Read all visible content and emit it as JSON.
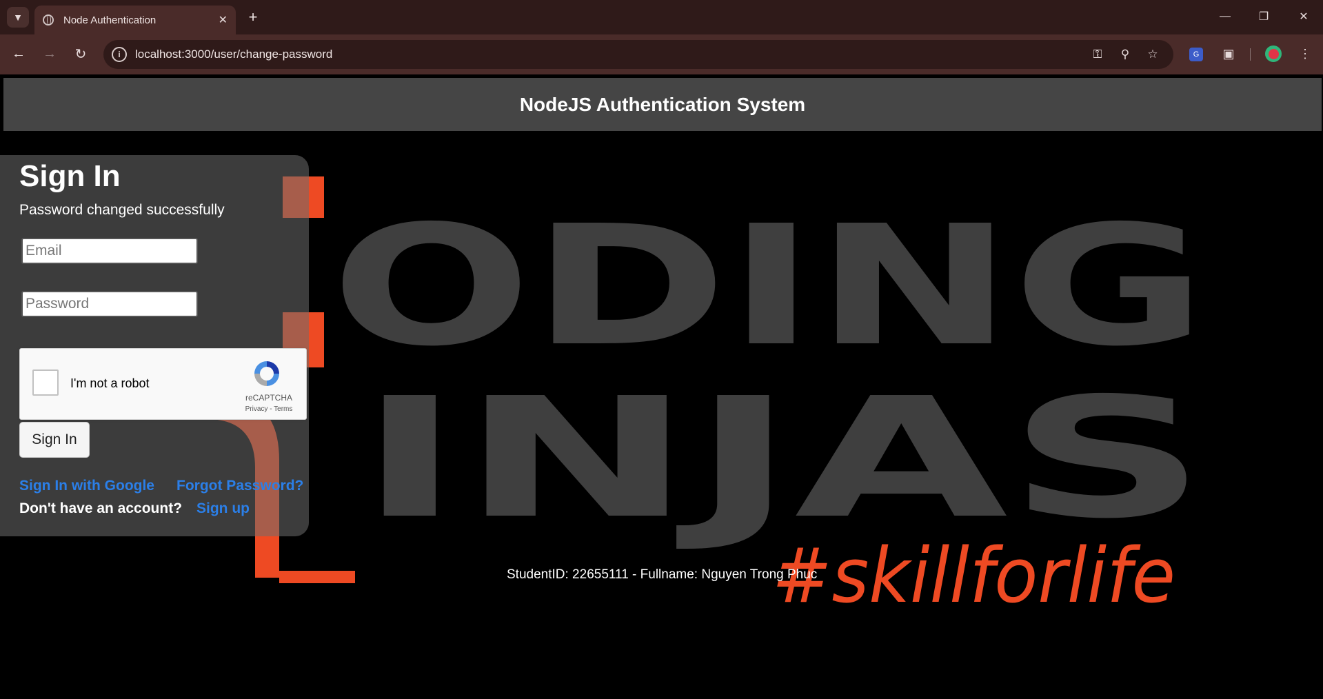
{
  "browser": {
    "tab_title": "Node Authentication",
    "url": "localhost:3000/user/change-password",
    "new_tab_symbol": "+",
    "close_symbol": "✕"
  },
  "page": {
    "header_title": "NodeJS Authentication System",
    "background": {
      "logo_line1": "ODING",
      "logo_line2": "INJAS",
      "hashtag": "#skillforlife",
      "accent_color": "#ee4a23"
    },
    "footer_text": "StudentID: 22655111 - Fullname: Nguyen Trong Phuc"
  },
  "signin": {
    "title": "Sign In",
    "message": "Password changed successfully",
    "email_placeholder": "Email",
    "password_placeholder": "Password",
    "recaptcha": {
      "label": "I'm not a robot",
      "brand": "reCAPTCHA",
      "links": "Privacy - Terms"
    },
    "submit_label": "Sign In",
    "google_link": "Sign In with Google",
    "forgot_link": "Forgot Password?",
    "no_account_text": "Don't have an account?",
    "signup_link": "Sign up",
    "link_color": "#2b7fe8"
  }
}
